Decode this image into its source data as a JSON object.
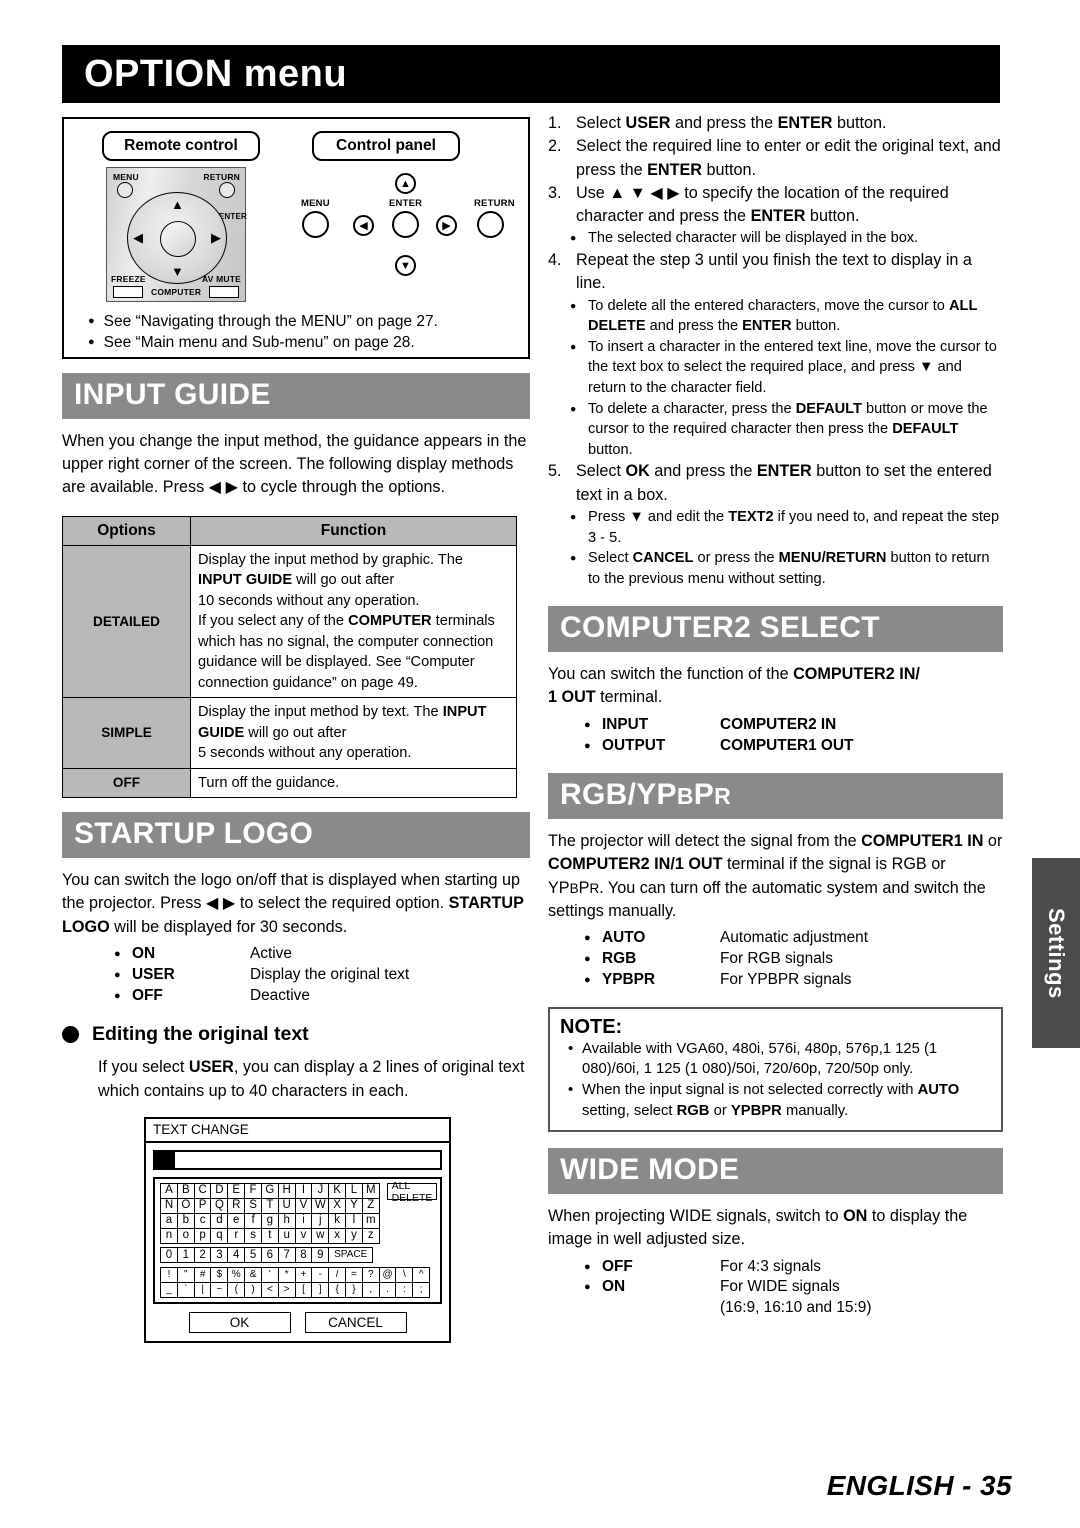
{
  "page": {
    "title": "OPTION menu",
    "footer_text": "ENGLISH - 35",
    "side_tab": "Settings"
  },
  "nav_box": {
    "remote_label": "Remote control",
    "panel_label": "Control panel",
    "remote_buttons": {
      "menu": "MENU",
      "return": "RETURN",
      "enter": "ENTER",
      "freeze": "FREEZE",
      "av_mute": "AV MUTE",
      "computer": "COMPUTER",
      "up": "▲",
      "down": "▼",
      "left": "◀",
      "right": "▶"
    },
    "panel_buttons": {
      "menu": "MENU",
      "enter": "ENTER",
      "return": "RETURN",
      "up": "▲",
      "down": "▼",
      "left": "◀",
      "right": "▶"
    },
    "notes": [
      "See “Navigating through the MENU” on page 27.",
      "See “Main menu and Sub-menu” on page 28."
    ]
  },
  "input_guide": {
    "heading": "INPUT GUIDE",
    "paragraph": "When you change the input method, the guidance appears in the upper right corner of the screen. The following display methods are available. Press ◀ ▶ to cycle through the options.",
    "table": {
      "headers": [
        "Options",
        "Function"
      ],
      "rows": [
        {
          "option": "DETAILED",
          "function": "Display the input method by graphic. The INPUT GUIDE will go out after 10 seconds without any operation. If you select any of the COMPUTER terminals which has no signal, the computer connection guidance will be displayed. See “Computer connection guidance” on page 49."
        },
        {
          "option": "SIMPLE",
          "function": "Display the input method by text. The INPUT GUIDE will go out after 5 seconds without any operation."
        },
        {
          "option": "OFF",
          "function": "Turn off the guidance."
        }
      ]
    }
  },
  "startup_logo": {
    "heading": "STARTUP LOGO",
    "paragraph": "You can switch the logo on/off that is displayed when starting up the projector. Press ◀ ▶ to select the required option. STARTUP LOGO will be displayed for 30 seconds.",
    "options": [
      {
        "key": "ON",
        "value": "Active"
      },
      {
        "key": "USER",
        "value": "Display the original text"
      },
      {
        "key": "OFF",
        "value": "Deactive"
      }
    ],
    "subheading": "Editing the original text",
    "sub_paragraph": "If you select USER, you can display a 2 lines of original text which contains up to 40 characters in each."
  },
  "text_change_dialog": {
    "title": "TEXT CHANGE",
    "input_value": "",
    "all_delete_label": "ALL DELETE",
    "space_label": "SPACE",
    "rows": [
      [
        "A",
        "B",
        "C",
        "D",
        "E",
        "F",
        "G",
        "H",
        "I",
        "J",
        "K",
        "L",
        "M"
      ],
      [
        "N",
        "O",
        "P",
        "Q",
        "R",
        "S",
        "T",
        "U",
        "V",
        "W",
        "X",
        "Y",
        "Z"
      ],
      [
        "a",
        "b",
        "c",
        "d",
        "e",
        "f",
        "g",
        "h",
        "i",
        "j",
        "k",
        "l",
        "m"
      ],
      [
        "n",
        "o",
        "p",
        "q",
        "r",
        "s",
        "t",
        "u",
        "v",
        "w",
        "x",
        "y",
        "z"
      ],
      [
        "0",
        "1",
        "2",
        "3",
        "4",
        "5",
        "6",
        "7",
        "8",
        "9"
      ],
      [
        "!",
        "\"",
        "#",
        "$",
        "%",
        "&",
        "'",
        "*",
        "+",
        "-",
        "/",
        "=",
        "?",
        "@",
        "\\",
        "^"
      ],
      [
        "_",
        "`",
        "|",
        "~",
        "(",
        ")",
        "<",
        ">",
        "[",
        "]",
        "{",
        "}",
        ",",
        ".",
        ":",
        ";"
      ]
    ],
    "ok_label": "OK",
    "cancel_label": "CANCEL"
  },
  "steps": [
    {
      "num": "1.",
      "text": "Select USER and press the ENTER button.",
      "subs": []
    },
    {
      "num": "2.",
      "text": "Select the required line to enter or edit the original text, and press the ENTER button.",
      "subs": []
    },
    {
      "num": "3.",
      "text": "Use ▲ ▼ ◀ ▶ to specify the location of the required character and press the ENTER button.",
      "subs": [
        "The selected character will be displayed in the box."
      ]
    },
    {
      "num": "4.",
      "text": "Repeat the step 3 until you finish the text to display in a line.",
      "subs": [
        "To delete all the entered characters, move the cursor to ALL DELETE and press the ENTER button.",
        "To insert a character in the entered text line, move the cursor to the text box to select the required place, and press ▼ and return to the character field.",
        "To delete a character, press the DEFAULT button or move the cursor to the required character then press the DEFAULT button."
      ]
    },
    {
      "num": "5.",
      "text": "Select OK and press the ENTER button to set the entered text in a box.",
      "subs": [
        "Press ▼ and edit the TEXT2 if you need to, and repeat the step 3 - 5.",
        "Select CANCEL or press the MENU/RETURN button to return to the previous menu without setting."
      ]
    }
  ],
  "computer2_select": {
    "heading": "COMPUTER2 SELECT",
    "paragraph": "You can switch the function of the COMPUTER2 IN/1 OUT terminal.",
    "options": [
      {
        "key": "INPUT",
        "value": "COMPUTER2 IN"
      },
      {
        "key": "OUTPUT",
        "value": "COMPUTER1 OUT"
      }
    ]
  },
  "rgb_ypbpr": {
    "heading_main": "RGB/YP",
    "heading_sub1": "B",
    "heading_mid": "P",
    "heading_sub2": "R",
    "paragraph": "The projector will detect the signal from the COMPUTER1 IN or COMPUTER2 IN/1 OUT terminal if the signal is RGB or YPBPR. You can turn off the automatic system and switch the settings manually.",
    "options": [
      {
        "key": "AUTO",
        "value": "Automatic adjustment"
      },
      {
        "key": "RGB",
        "value": "For RGB signals"
      },
      {
        "key": "YPBPR",
        "value": "For YPBPR signals"
      }
    ],
    "note": {
      "title": "NOTE:",
      "items": [
        "Available with VGA60, 480i, 576i, 480p, 576p,1 125 (1 080)/60i, 1 125 (1 080)/50i, 720/60p, 720/50p only.",
        "When the input signal is not selected correctly with AUTO setting, select RGB or YPBPR manually."
      ]
    }
  },
  "wide_mode": {
    "heading": "WIDE MODE",
    "paragraph": "When projecting WIDE signals, switch to ON to display the image in well adjusted size.",
    "options": [
      {
        "key": "OFF",
        "value": "For 4:3 signals"
      },
      {
        "key": "ON",
        "value": "For WIDE signals"
      }
    ],
    "on_extra": "(16:9, 16:10 and 15:9)"
  },
  "colors": {
    "section_header_bg": "#8a8a8a",
    "title_bar_bg": "#000000",
    "side_tab_bg": "#4b4b4b",
    "table_header_bg": "#b9b9b9"
  }
}
